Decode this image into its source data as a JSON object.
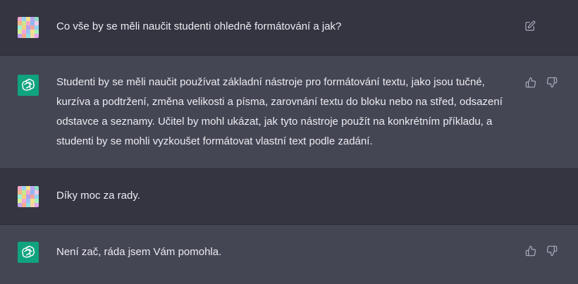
{
  "conversation": {
    "turns": [
      {
        "role": "user",
        "text": "Co vše by se měli naučit studenti ohledně formátování a jak?",
        "icons": [
          "edit-icon"
        ]
      },
      {
        "role": "assistant",
        "text": "Studenti by se měli naučit používat základní nástroje pro formátování textu, jako jsou tučné, kurzíva a podtržení, změna velikosti a písma, zarovnání textu do bloku nebo na střed, odsazení odstavce a seznamy. Učitel by mohl ukázat, jak tyto nástroje použít na konkrétním příkladu, a studenti by se mohli vyzkoušet formátovat vlastní text podle zadání.",
        "icons": [
          "thumbs-up-icon",
          "thumbs-down-icon"
        ]
      },
      {
        "role": "user",
        "text": "Díky moc za rady.",
        "icons": []
      },
      {
        "role": "assistant",
        "text": "Není zač, ráda jsem Vám pomohla.",
        "icons": [
          "thumbs-up-icon",
          "thumbs-down-icon"
        ]
      }
    ]
  },
  "colors": {
    "user_background": "#343541",
    "assistant_background": "#444654",
    "text": "#ececf1",
    "assistant_avatar": "#10a37f",
    "icon": "#acacbe"
  },
  "user_avatar_palette": [
    "#f2a7c9",
    "#9ad1f5",
    "#f7e08a",
    "#b9a6f2",
    "#8fe0c6",
    "#f7b58a",
    "#c7e88f",
    "#f2a7c9",
    "#8fb8f2",
    "#f2c7e8",
    "#9af0d9",
    "#f5d27a",
    "#b7a1f0",
    "#f4a3a3",
    "#8fd4f2",
    "#d8f08f",
    "#f2a7d9",
    "#9ac2f5",
    "#f7e08a",
    "#a6f2b9",
    "#c1a6f2",
    "#f7a98a",
    "#8fe0e0",
    "#f2d7a7",
    "#e3a6f2"
  ]
}
